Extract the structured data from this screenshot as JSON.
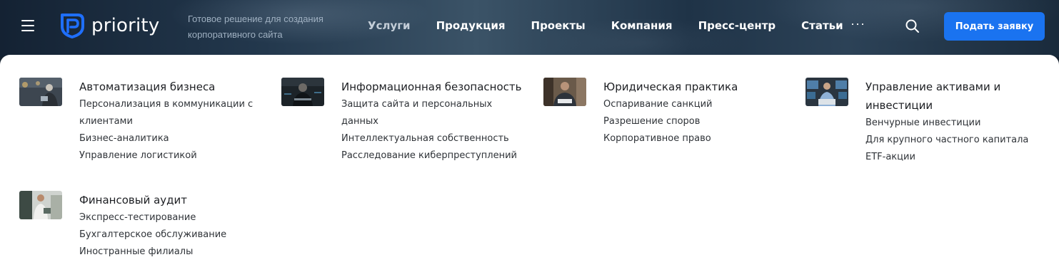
{
  "header": {
    "brand": "priority",
    "tagline": "Готовое решение для создания корпоративного сайта",
    "nav": [
      {
        "label": "Услуги"
      },
      {
        "label": "Продукция"
      },
      {
        "label": "Проекты"
      },
      {
        "label": "Компания"
      },
      {
        "label": "Пресс-центр"
      },
      {
        "label": "Статьи"
      }
    ],
    "more": "···",
    "cta": "Подать заявку",
    "accent": "#1a73f0"
  },
  "menu": {
    "groups": [
      {
        "title": "Автоматизация бизнеса",
        "items": [
          "Персонализация в коммуникации с клиентами",
          "Бизнес-аналитика",
          "Управление логистикой"
        ]
      },
      {
        "title": "Информационная безопасность",
        "items": [
          "Защита сайта и персональных данных",
          "Интеллектуальная собственность",
          "Расследование киберпреступлений"
        ]
      },
      {
        "title": "Юридическая практика",
        "items": [
          "Оспаривание санкций",
          "Разрешение споров",
          "Корпоративное право"
        ]
      },
      {
        "title": "Управление активами и инвестиции",
        "items": [
          "Венчурные инвестиции",
          "Для крупного частного капитала",
          "ETF-акции"
        ]
      },
      {
        "title": "Финансовый аудит",
        "items": [
          "Экспресс-тестирование",
          "Бухгалтерское обслуживание",
          "Иностранные филиалы"
        ]
      }
    ]
  }
}
